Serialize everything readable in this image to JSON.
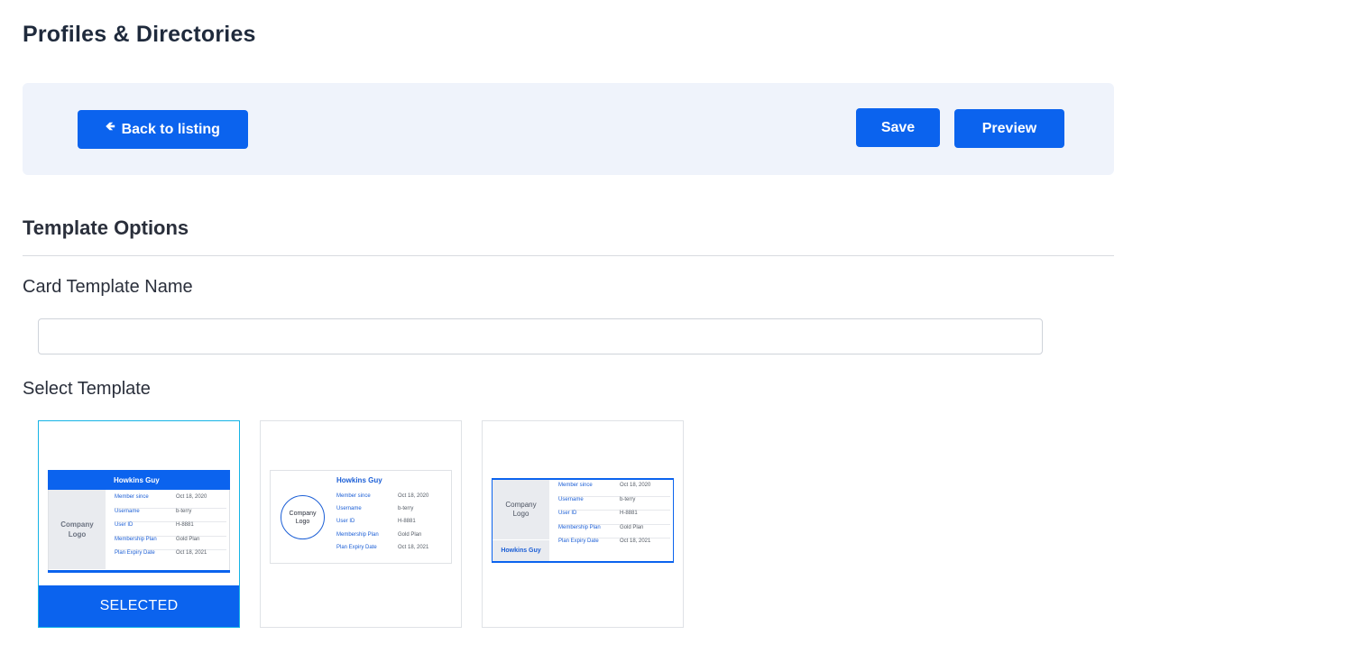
{
  "page": {
    "title": "Profiles & Directories"
  },
  "toolbar": {
    "back_label": "Back to listing",
    "back_icon": "arrow-left-icon",
    "save_label": "Save",
    "preview_label": "Preview"
  },
  "template_options": {
    "heading": "Template Options",
    "card_name_label": "Card Template Name",
    "card_name_value": "",
    "card_name_placeholder": "",
    "select_label": "Select Template",
    "selected_label": "SELECTED",
    "selected_index": 0
  },
  "sample_card": {
    "name": "Howkins Guy",
    "logo_line1": "Company",
    "logo_line2": "Logo",
    "fields": [
      {
        "key": "Member since",
        "value": "Oct 18, 2020"
      },
      {
        "key": "Username",
        "value": "b-terry"
      },
      {
        "key": "User ID",
        "value": "H-8881"
      },
      {
        "key": "Membership Plan",
        "value": "Gold Plan"
      },
      {
        "key": "Plan Expiry Date",
        "value": "Oct 18, 2021"
      }
    ]
  },
  "colors": {
    "primary": "#0b63ee",
    "toolbar_bg": "#eff3fb",
    "selected_border": "#15b4e6",
    "logo_bg": "#e9ebef"
  }
}
